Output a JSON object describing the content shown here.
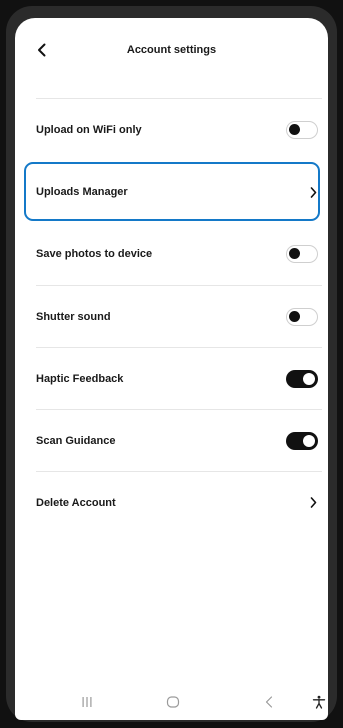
{
  "header": {
    "title": "Account settings"
  },
  "settings": [
    {
      "label": "Upload on WiFi only",
      "control": "toggle",
      "state": "off"
    },
    {
      "label": "Uploads Manager",
      "control": "chevron",
      "highlighted": true
    },
    {
      "label": "Save photos to device",
      "control": "toggle",
      "state": "off"
    },
    {
      "label": "Shutter sound",
      "control": "toggle",
      "state": "off"
    },
    {
      "label": "Haptic Feedback",
      "control": "toggle",
      "state": "on"
    },
    {
      "label": "Scan Guidance",
      "control": "toggle",
      "state": "on"
    },
    {
      "label": "Delete Account",
      "control": "chevron"
    }
  ],
  "icons": {
    "back": "chevron-left-icon",
    "nav_recents": "recents-icon",
    "nav_home": "home-icon",
    "nav_back": "nav-back-icon",
    "nav_accessibility": "accessibility-icon"
  },
  "colors": {
    "highlight": "#1479c8",
    "toggle_on": "#111111",
    "text": "#1a1a1a"
  }
}
